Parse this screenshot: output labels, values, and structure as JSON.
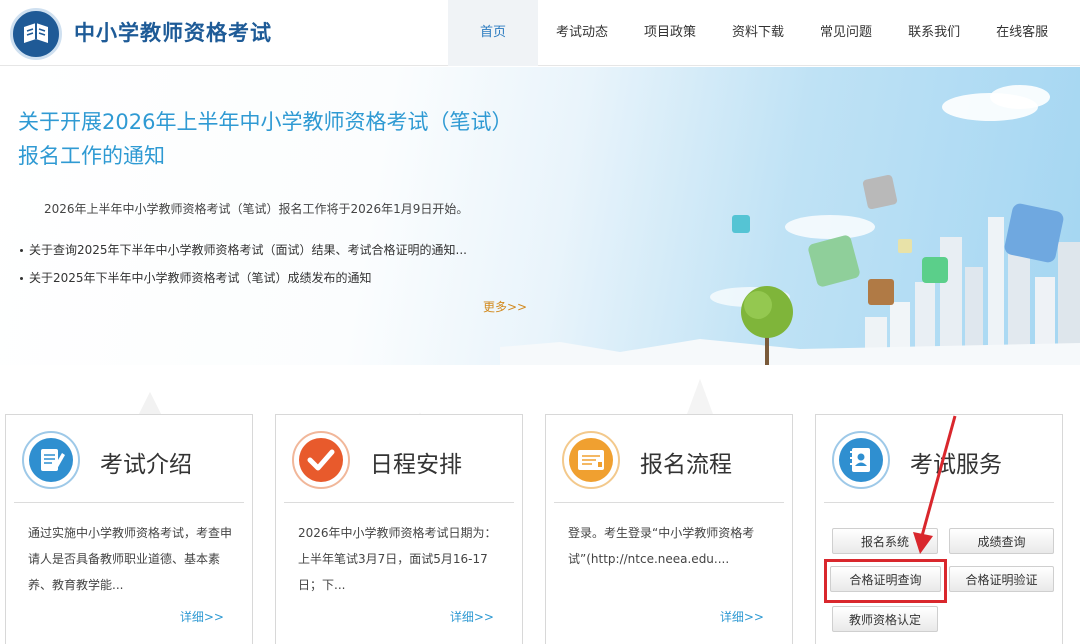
{
  "header": {
    "site_title": "中小学教师资格考试",
    "nav": [
      "首页",
      "考试动态",
      "项目政策",
      "资料下载",
      "常见问题",
      "联系我们",
      "在线客服"
    ],
    "active_nav": "首页"
  },
  "banner": {
    "title": "关于开展2026年上半年中小学教师资格考试（笔试）报名工作的通知",
    "summary": "2026年上半年中小学教师资格考试（笔试）报名工作将于2026年1月9日开始。",
    "news": [
      "关于查询2025年下半年中小学教师资格考试（面试）结果、考试合格证明的通知...",
      "关于2025年下半年中小学教师资格考试（笔试）成绩发布的通知"
    ],
    "more": "更多>>"
  },
  "cards": [
    {
      "title": "考试介绍",
      "text": "通过实施中小学教师资格考试，考查申请人是否具备教师职业道德、基本素养、教育教学能...",
      "more": "详细>>",
      "icon": "document-pen-icon"
    },
    {
      "title": "日程安排",
      "text": "2026年中小学教师资格考试日期为：上半年笔试3月7日，面试5月16-17日；下...",
      "more": "详细>>",
      "icon": "checkmark-icon"
    },
    {
      "title": "报名流程",
      "text": "登录。考生登录“中小学教师资格考试”(http://ntce.neea.edu....",
      "more": "详细>>",
      "icon": "form-icon"
    },
    {
      "title": "考试服务",
      "icon": "contacts-book-icon"
    }
  ],
  "services": [
    "报名系统",
    "成绩查询",
    "合格证明查询",
    "合格证明验证",
    "教师资格认定"
  ],
  "colors": {
    "accent": "#2f9ad3",
    "brand": "#1e5b97",
    "highlight": "#d9272d",
    "more": "#d28a1f"
  }
}
